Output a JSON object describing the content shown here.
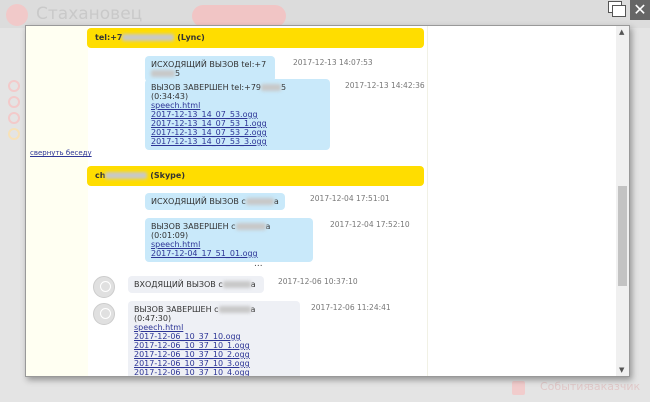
{
  "background_app": {
    "brand": "Стахановец",
    "button_label": "",
    "bottom_label": "События",
    "bottom_label2": "заказчик"
  },
  "conversations": [
    {
      "header_prefix": "tel:+7",
      "header_suffix": " (Lync)",
      "messages": [
        {
          "direction": "outgoing",
          "text_prefix": "ИСХОДЯЩИЙ ВЫЗОВ tel:+7",
          "text_suffix": "5",
          "timestamp": "2017-12-13 14:07:53",
          "links": []
        },
        {
          "direction": "outgoing",
          "text_prefix": "ВЫЗОВ ЗАВЕРШЕН tel:+79",
          "text_suffix": "5 (0:34:43)",
          "timestamp": "2017-12-13 14:42:36",
          "links": [
            "speech.html",
            "2017-12-13_14_07_53.ogg",
            "2017-12-13_14_07_53_1.ogg",
            "2017-12-13_14_07_53_2.ogg",
            "2017-12-13_14_07_53_3.ogg"
          ]
        }
      ],
      "collapse_label": "свернуть беседу"
    },
    {
      "header_prefix": "ch",
      "header_suffix": " (Skype)",
      "messages": [
        {
          "direction": "outgoing",
          "text_prefix": "ИСХОДЯЩИЙ ВЫЗОВ c",
          "text_suffix": "a",
          "timestamp": "2017-12-04 17:51:01",
          "links": []
        },
        {
          "direction": "outgoing",
          "text_prefix": "ВЫЗОВ ЗАВЕРШЕН c",
          "text_suffix": "a (0:01:09)",
          "timestamp": "2017-12-04 17:52:10",
          "links": [
            "speech.html",
            "2017-12-04_17_51_01.ogg"
          ]
        },
        {
          "direction": "incoming",
          "text_prefix": "ВХОДЯЩИЙ ВЫЗОВ c",
          "text_suffix": "a",
          "timestamp": "2017-12-06 10:37:10",
          "links": []
        },
        {
          "direction": "incoming",
          "text_prefix": "ВЫЗОВ ЗАВЕРШЕН c",
          "text_suffix": "a (0:47:30)",
          "timestamp": "2017-12-06 11:24:41",
          "links": [
            "speech.html",
            "2017-12-06_10_37_10.ogg",
            "2017-12-06_10_37_10_1.ogg",
            "2017-12-06_10_37_10_2.ogg",
            "2017-12-06_10_37_10_3.ogg",
            "2017-12-06_10_37_10_4.ogg"
          ]
        }
      ],
      "more_label": "..."
    }
  ],
  "colors": {
    "header": "#ffdd00",
    "outgoing": "#c9e9fa",
    "incoming": "#eef0f5",
    "link": "#2d3596"
  }
}
